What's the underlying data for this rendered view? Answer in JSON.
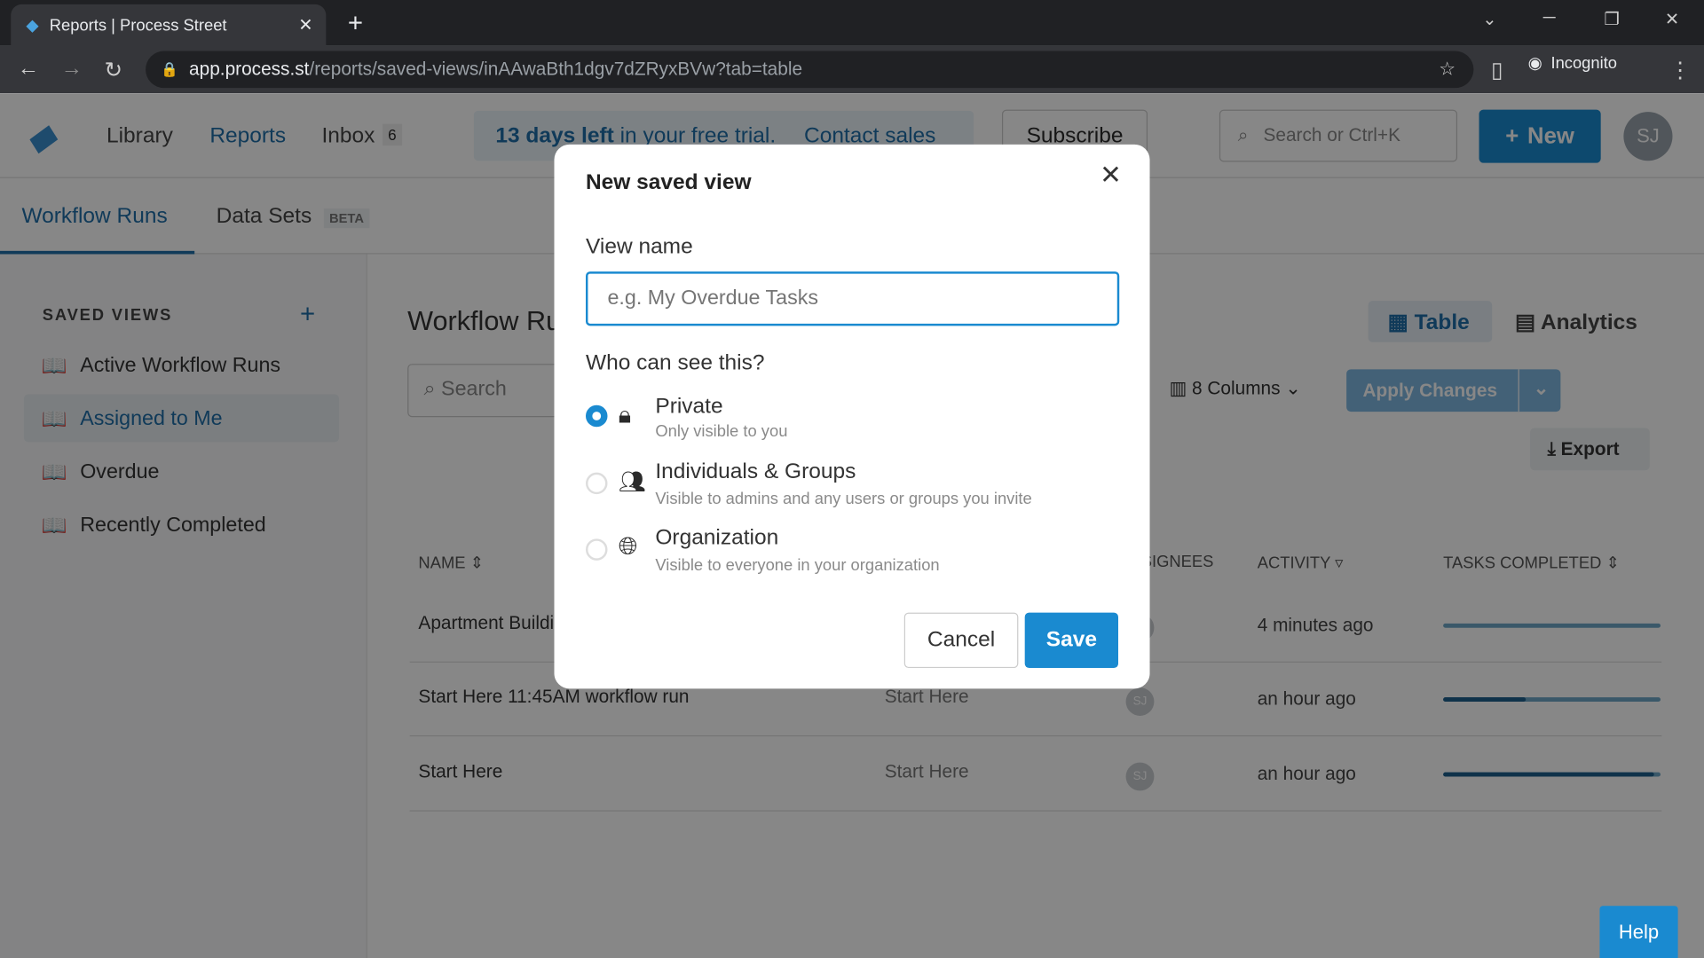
{
  "browser": {
    "tab_title": "Reports | Process Street",
    "url_host": "app.process.st",
    "url_path": "/reports/saved-views/inAAwaBth1dgv7dZRyxBVw?tab=table",
    "profile": "Incognito"
  },
  "header": {
    "nav": [
      "Library",
      "Reports",
      "Inbox"
    ],
    "inbox_count": "6",
    "trial_bold": "13 days left",
    "trial_rest": "in your free trial.",
    "contact": "Contact sales",
    "subscribe": "Subscribe",
    "search_placeholder": "Search or Ctrl+K",
    "new_label": "New",
    "avatar": "SJ"
  },
  "subnav": {
    "tabs": [
      "Workflow Runs",
      "Data Sets"
    ],
    "beta": "BETA"
  },
  "sidebar": {
    "heading": "SAVED VIEWS",
    "items": [
      "Active Workflow Runs",
      "Assigned to Me",
      "Overdue",
      "Recently Completed"
    ]
  },
  "main": {
    "title": "Workflow Runs",
    "search_placeholder": "Search",
    "view_table": "Table",
    "view_analytics": "Analytics",
    "columns": "8 Columns",
    "apply": "Apply Changes",
    "export": "Export",
    "headers": [
      "NAME",
      "ASSIGNEES",
      "ACTIVITY",
      "TASKS COMPLETED"
    ],
    "rows": [
      {
        "name": "Apartment Building",
        "workflow": "",
        "assignee": "SJ",
        "activity": "4 minutes ago",
        "progress": 0
      },
      {
        "name": "Start Here 11:45AM workflow run",
        "workflow": "Start Here",
        "assignee": "SJ",
        "activity": "an hour ago",
        "progress": 0.38
      },
      {
        "name": "Start Here",
        "workflow": "Start Here",
        "assignee": "SJ",
        "activity": "an hour ago",
        "progress": 0.97
      }
    ]
  },
  "modal": {
    "title": "New saved view",
    "field_label": "View name",
    "placeholder": "e.g. My Overdue Tasks",
    "who_label": "Who can see this?",
    "options": [
      {
        "title": "Private",
        "desc": "Only visible to you",
        "selected": true,
        "icon": "lock-icon"
      },
      {
        "title": "Individuals & Groups",
        "desc": "Visible to admins and any users or groups you invite",
        "selected": false,
        "icon": "users-icon"
      },
      {
        "title": "Organization",
        "desc": "Visible to everyone in your organization",
        "selected": false,
        "icon": "globe-icon"
      }
    ],
    "cancel": "Cancel",
    "save": "Save"
  },
  "help": "Help",
  "colors": {
    "accent": "#1a8ad0",
    "progress": "#1d5f8d"
  }
}
